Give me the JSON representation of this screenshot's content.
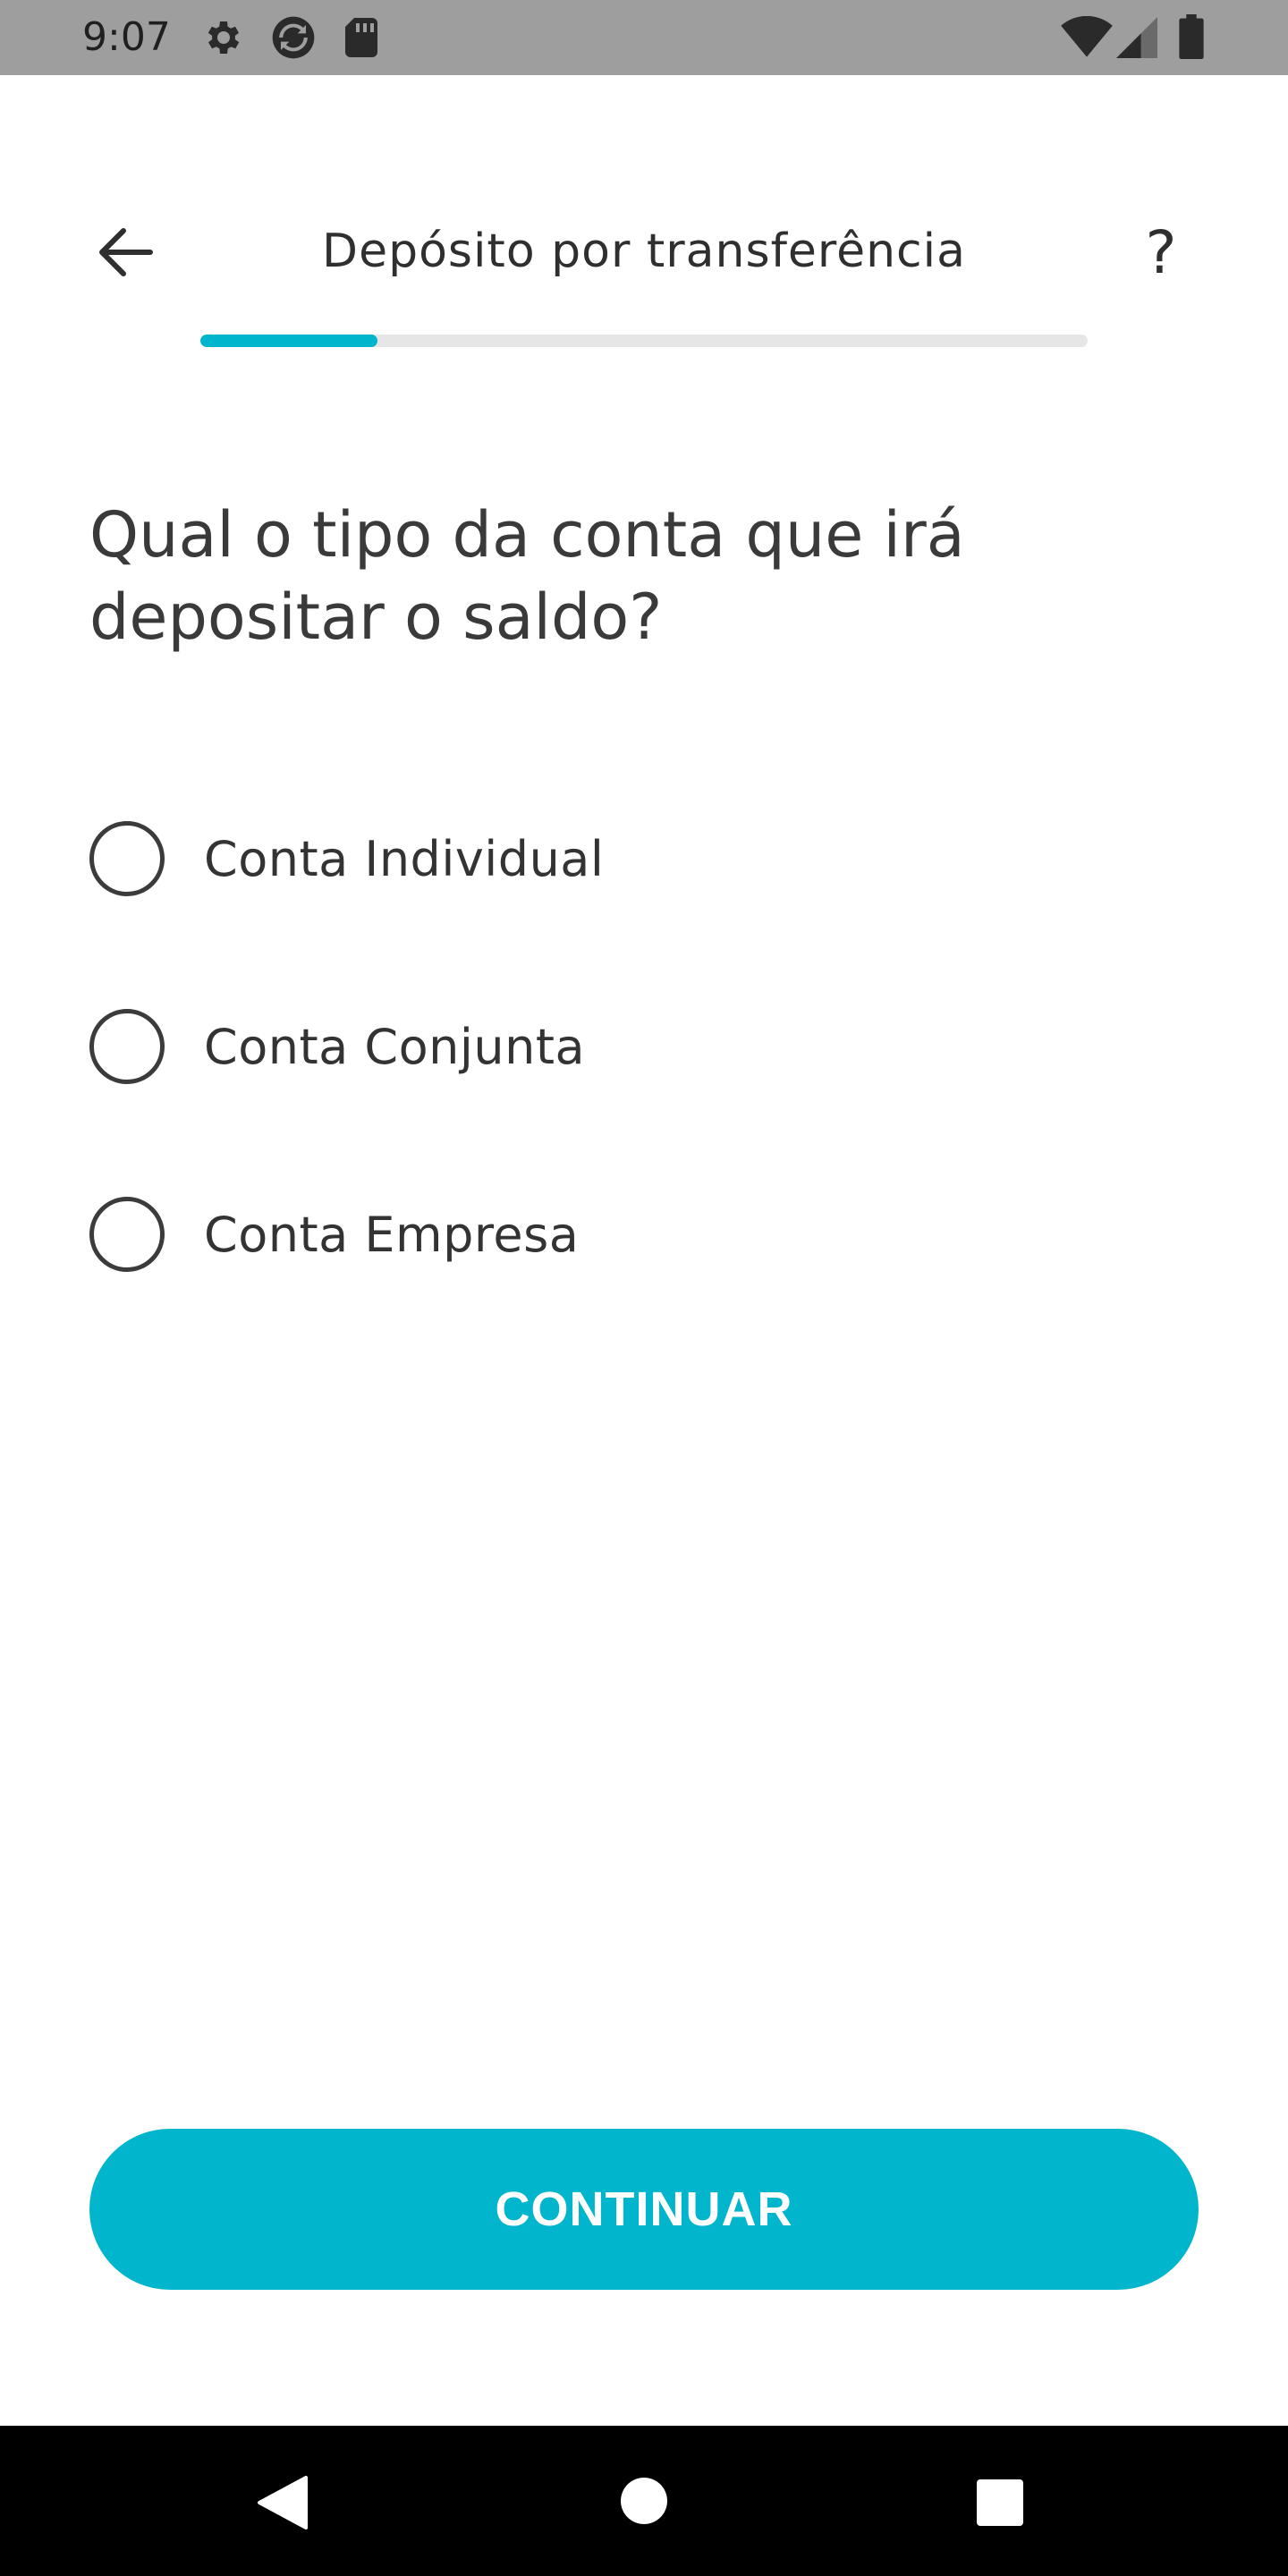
{
  "status_bar": {
    "time": "9:07",
    "icons": [
      "gear-icon",
      "sync-icon",
      "sd-card-icon",
      "wifi-icon",
      "signal-icon",
      "battery-icon"
    ]
  },
  "app_bar": {
    "title": "Depósito por transferência",
    "back_icon": "arrow-left-icon",
    "help_label": "?"
  },
  "progress": {
    "value": 0.2,
    "track_color": "#e6e6e6",
    "fill_color": "#00b5cc"
  },
  "question": {
    "text": "Qual o tipo da conta que irá depositar o saldo?"
  },
  "options": [
    {
      "label": "Conta Individual",
      "selected": false
    },
    {
      "label": "Conta Conjunta",
      "selected": false
    },
    {
      "label": "Conta Empresa",
      "selected": false
    }
  ],
  "continue_button": {
    "label": "CONTINUAR",
    "color": "#00b5cc"
  },
  "nav_bar": {
    "icons": [
      "nav-back-icon",
      "nav-home-icon",
      "nav-recents-icon"
    ]
  }
}
